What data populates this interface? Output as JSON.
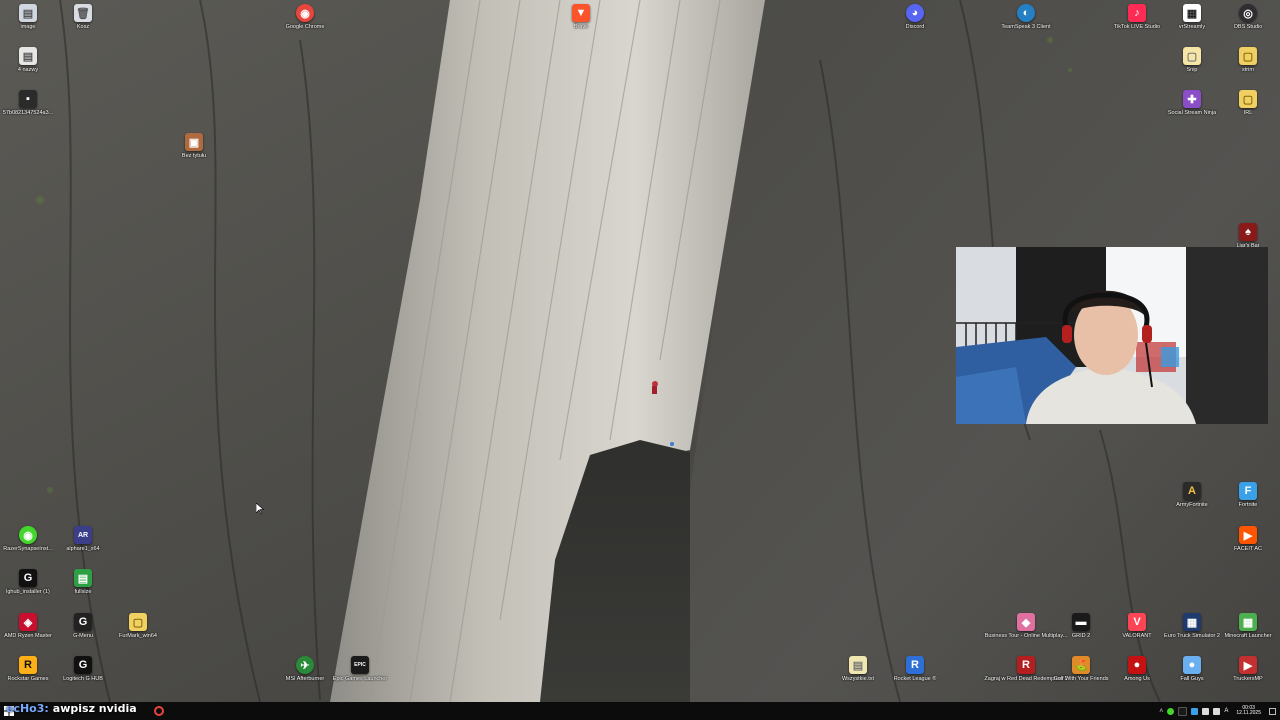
{
  "desktop": {
    "icons": [
      {
        "key": "image",
        "label": "image",
        "color": "#cfd6e0",
        "glyph": "▤"
      },
      {
        "key": "kosz",
        "label": "Kosz",
        "color": "#d9dde3",
        "glyph": "🗑"
      },
      {
        "key": "chrome",
        "label": "Google Chrome",
        "color": "#e8453c",
        "glyph": "◉"
      },
      {
        "key": "brave",
        "label": "Brave",
        "color": "#fb542b",
        "glyph": "▼"
      },
      {
        "key": "discord",
        "label": "Discord",
        "color": "#5865f2",
        "glyph": "◕"
      },
      {
        "key": "teamspeak",
        "label": "TeamSpeak 3 Client",
        "color": "#2580c3",
        "glyph": "◐"
      },
      {
        "key": "tiktok",
        "label": "TikTok LIVE Studio",
        "color": "#fe2c55",
        "glyph": "♪"
      },
      {
        "key": "vrstreamly",
        "label": "vrStreamly",
        "color": "#ffffff",
        "glyph": "▦"
      },
      {
        "key": "obs",
        "label": "OBS Studio",
        "color": "#302e31",
        "glyph": "◎"
      },
      {
        "key": "4nazwy",
        "label": "4 nazwy",
        "color": "#e6e6e6",
        "glyph": "▤"
      },
      {
        "key": "snip",
        "label": "Snip",
        "color": "#f5e6a8",
        "glyph": "▢"
      },
      {
        "key": "strim",
        "label": "strim",
        "color": "#f0d060",
        "glyph": "▢"
      },
      {
        "key": "hash",
        "label": "57b0821347524a3...",
        "color": "#2b2b2b",
        "glyph": "▪"
      },
      {
        "key": "ssn",
        "label": "Social Stream Ninja",
        "color": "#8a4fc8",
        "glyph": "✚"
      },
      {
        "key": "irl",
        "label": "IRL",
        "color": "#f0d060",
        "glyph": "▢"
      },
      {
        "key": "bez",
        "label": "Bez tytułu",
        "color": "#b06a40",
        "glyph": "▣"
      },
      {
        "key": "liars",
        "label": "Liar's Bar",
        "color": "#8a1a1a",
        "glyph": "♠"
      },
      {
        "key": "armyfortnite",
        "label": "ArmyFortnite",
        "color": "#2a2a2a",
        "glyph": "A"
      },
      {
        "key": "fortnite",
        "label": "Fortnite",
        "color": "#3aa0e8",
        "glyph": "F"
      },
      {
        "key": "faceit",
        "label": "FACEIT AC",
        "color": "#ff5500",
        "glyph": "▶"
      },
      {
        "key": "razer",
        "label": "RazerSynapseInst...",
        "color": "#44d62c",
        "glyph": "◉"
      },
      {
        "key": "alphare",
        "label": "alphare1_x64",
        "color": "#3b3f8a",
        "glyph": "AR"
      },
      {
        "key": "lghub",
        "label": "lghub_installer (1)",
        "color": "#111111",
        "glyph": "G"
      },
      {
        "key": "fullsize",
        "label": "fullsize",
        "color": "#2ea043",
        "glyph": "▤"
      },
      {
        "key": "ryzen",
        "label": "AMD Ryzen Master",
        "color": "#c8102e",
        "glyph": "◈"
      },
      {
        "key": "gmenu",
        "label": "G-Menu",
        "color": "#222222",
        "glyph": "G"
      },
      {
        "key": "furmark",
        "label": "FurMark_win64",
        "color": "#f0d060",
        "glyph": "▢"
      },
      {
        "key": "rockstar",
        "label": "Rockstar Games",
        "color": "#fcaf17",
        "glyph": "R"
      },
      {
        "key": "ghub",
        "label": "Logitech G HUB",
        "color": "#111111",
        "glyph": "G"
      },
      {
        "key": "afterburner",
        "label": "MSI Afterburner",
        "color": "#2a8a3a",
        "glyph": "✈"
      },
      {
        "key": "epic",
        "label": "Epic Games Launcher",
        "color": "#1b1b1b",
        "glyph": "EPIC"
      },
      {
        "key": "businesstour",
        "label": "Business Tour - Online Multiplay...",
        "color": "#e070a0",
        "glyph": "◆"
      },
      {
        "key": "grid2",
        "label": "GRID 2",
        "color": "#1a1a1a",
        "glyph": "▬"
      },
      {
        "key": "valorant",
        "label": "VALORANT",
        "color": "#fd4556",
        "glyph": "V"
      },
      {
        "key": "ets2",
        "label": "Euro Truck Simulator 2",
        "color": "#1f3b6e",
        "glyph": "▦"
      },
      {
        "key": "minecraft",
        "label": "Minecraft Launcher",
        "color": "#4caf50",
        "glyph": "▦"
      },
      {
        "key": "wszystkie",
        "label": "Wszystkie.txt",
        "color": "#f0e6b0",
        "glyph": "▤"
      },
      {
        "key": "rocketleague",
        "label": "Rocket League ®",
        "color": "#2d6fd6",
        "glyph": "R"
      },
      {
        "key": "rdr",
        "label": "Zagraj w Red Dead Redemption 2",
        "color": "#b51e1e",
        "glyph": "R"
      },
      {
        "key": "golf",
        "label": "Golf With Your Friends",
        "color": "#e08a2a",
        "glyph": "⛳"
      },
      {
        "key": "amongus",
        "label": "Among Us",
        "color": "#c51111",
        "glyph": "●"
      },
      {
        "key": "fallguys",
        "label": "Fall Guys",
        "color": "#6ab0f0",
        "glyph": "●"
      },
      {
        "key": "truckersmp",
        "label": "TruckersMP",
        "color": "#c43030",
        "glyph": "▶"
      }
    ]
  },
  "chat": {
    "user": "ecHo3:",
    "message": "awpisz nvidia"
  },
  "taskbar": {
    "time": "00:03",
    "date": "12.11.2025"
  }
}
